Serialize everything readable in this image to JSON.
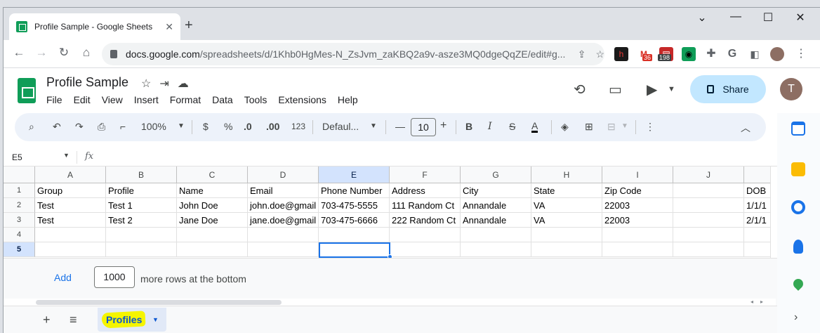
{
  "browser": {
    "tab_title": "Profile Sample - Google Sheets",
    "tab_close": "✕",
    "new_tab": "+",
    "url_domain": "docs.google.com",
    "url_path": "/spreadsheets/d/1Khb0HgMes-N_ZsJvm_zaKBQ2a9v-asze3MQ0dgeQqZE/edit#g...",
    "ext_badges": [
      "36",
      "198"
    ]
  },
  "sheets": {
    "doc_title": "Profile Sample",
    "menu": [
      "File",
      "Edit",
      "View",
      "Insert",
      "Format",
      "Data",
      "Tools",
      "Extensions",
      "Help"
    ],
    "share_label": "Share",
    "avatar_initial": "T"
  },
  "toolbar": {
    "zoom": "100%",
    "currency": "$",
    "percent": "%",
    "dec_decrease": ".0",
    "dec_increase": ".00",
    "more_formats": "123",
    "font": "Defaul...",
    "font_size": "10"
  },
  "formula_bar": {
    "name_box": "E5",
    "fx": "fx",
    "value": ""
  },
  "grid": {
    "columns": [
      "A",
      "B",
      "C",
      "D",
      "E",
      "F",
      "G",
      "H",
      "I",
      "J",
      ""
    ],
    "selected_column": "E",
    "rows": [
      "1",
      "2",
      "3",
      "4",
      "5"
    ],
    "selected_row": "5",
    "cells": [
      [
        "Group",
        "Profile",
        "Name",
        "Email",
        "Phone Number",
        "Address",
        "City",
        "State",
        "Zip Code",
        "",
        "DOB"
      ],
      [
        "Test",
        "Test 1",
        "John Doe",
        "john.doe@gmail",
        "703-475-5555",
        "111 Random Ct",
        "Annandale",
        "VA",
        "22003",
        "",
        "1/1/1"
      ],
      [
        "Test",
        "Test 2",
        "Jane Doe",
        "jane.doe@gmail",
        "703-475-6666",
        "222 Random Ct",
        "Annandale",
        "VA",
        "22003",
        "",
        "2/1/1"
      ],
      [
        "",
        "",
        "",
        "",
        "",
        "",
        "",
        "",
        "",
        "",
        ""
      ],
      [
        "",
        "",
        "",
        "",
        "",
        "",
        "",
        "",
        "",
        "",
        ""
      ]
    ],
    "active_cell": "E5"
  },
  "add_rows": {
    "button": "Add",
    "count": "1000",
    "suffix": "more rows at the bottom"
  },
  "sheet_tabs": {
    "add": "+",
    "list": "≡",
    "active": "Profiles"
  },
  "colors": {
    "accent": "#1a73e8",
    "share_bg": "#c2e7ff",
    "sheets_green": "#0f9d58",
    "highlight": "#f5f500"
  }
}
